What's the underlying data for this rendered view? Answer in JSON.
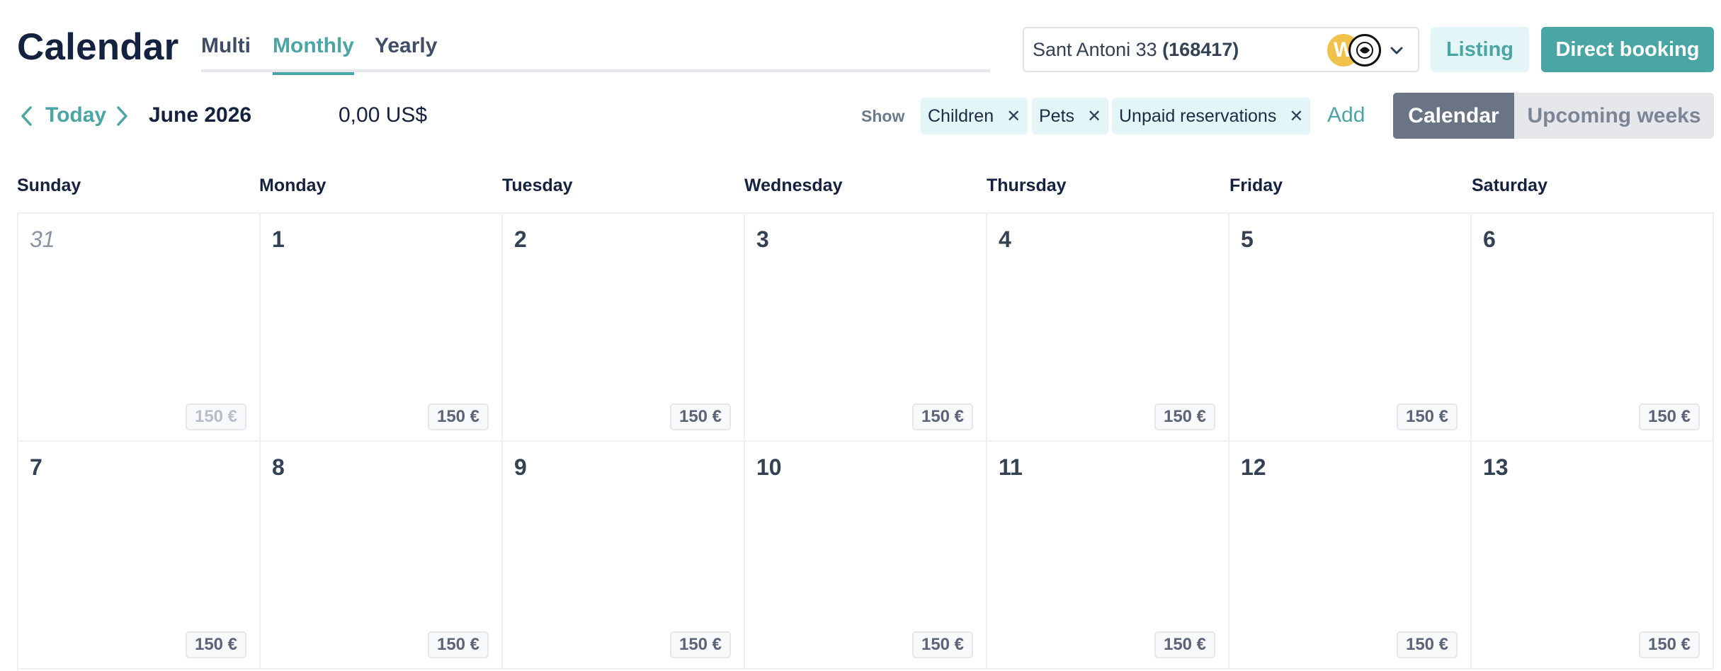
{
  "header": {
    "title": "Calendar",
    "tabs": [
      {
        "label": "Multi",
        "active": false
      },
      {
        "label": "Monthly",
        "active": true
      },
      {
        "label": "Yearly",
        "active": false
      }
    ]
  },
  "property_select": {
    "name": "Sant Antoni 33",
    "id": "(168417)",
    "avatar_letter": "W",
    "icon": "chevron-down-icon"
  },
  "actions": {
    "listing_label": "Listing",
    "direct_booking_label": "Direct booking"
  },
  "toolbar": {
    "today_label": "Today",
    "month_label": "June 2026",
    "amount": "0,00 US$",
    "show_label": "Show",
    "filters": [
      "Children",
      "Pets",
      "Unpaid reservations"
    ],
    "add_label": "Add",
    "view_toggle": {
      "calendar": "Calendar",
      "upcoming": "Upcoming weeks",
      "selected": "calendar"
    }
  },
  "weekdays": [
    "Sunday",
    "Monday",
    "Tuesday",
    "Wednesday",
    "Thursday",
    "Friday",
    "Saturday"
  ],
  "weeks": [
    [
      {
        "day": "31",
        "price": "150 €",
        "other_month": true
      },
      {
        "day": "1",
        "price": "150 €"
      },
      {
        "day": "2",
        "price": "150 €"
      },
      {
        "day": "3",
        "price": "150 €"
      },
      {
        "day": "4",
        "price": "150 €"
      },
      {
        "day": "5",
        "price": "150 €"
      },
      {
        "day": "6",
        "price": "150 €"
      }
    ],
    [
      {
        "day": "7",
        "price": "150 €"
      },
      {
        "day": "8",
        "price": "150 €"
      },
      {
        "day": "9",
        "price": "150 €"
      },
      {
        "day": "10",
        "price": "150 €"
      },
      {
        "day": "11",
        "price": "150 €"
      },
      {
        "day": "12",
        "price": "150 €"
      },
      {
        "day": "13",
        "price": "150 €"
      }
    ]
  ],
  "colors": {
    "accent": "#4aa6a4",
    "accent_light": "#e3f5f6",
    "toggle_active": "#6b7485",
    "toggle_inactive": "#e6e7ea",
    "title": "#15223f"
  }
}
